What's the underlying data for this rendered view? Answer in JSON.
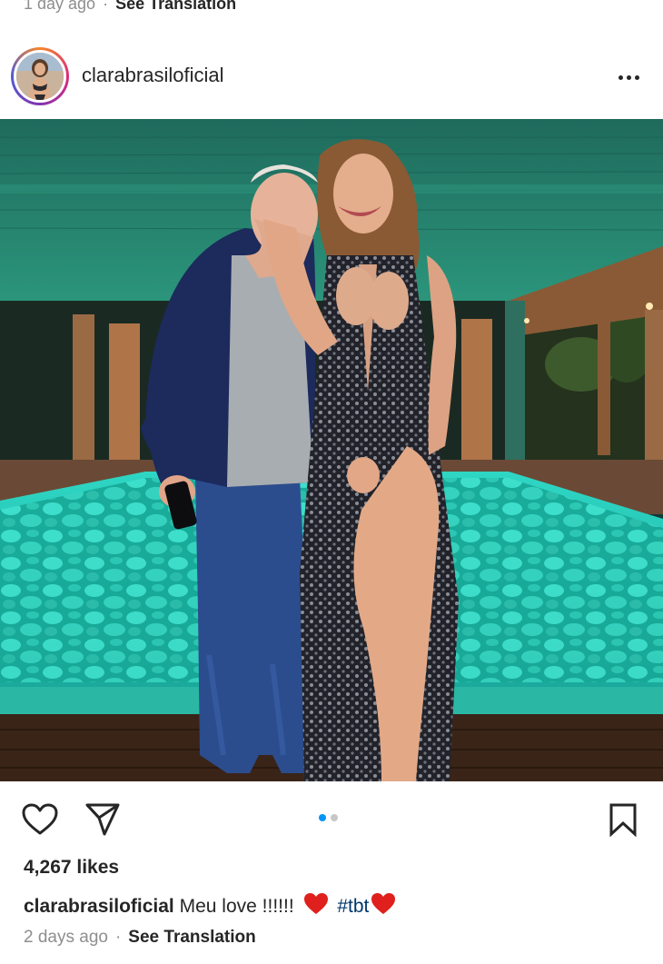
{
  "top": {
    "time": "1 day ago",
    "separator": "·",
    "translate": "See Translation"
  },
  "post": {
    "username": "clarabrasiloficial",
    "more_icon": "more-horizontal-icon",
    "image": {
      "description_icon": "photo",
      "pager": {
        "count": 2,
        "active": 0
      }
    },
    "likes": "4,267 likes",
    "caption": {
      "username": "clarabrasiloficial",
      "text": "Meu love !!!!!!",
      "hashtag": "#tbt"
    },
    "time": "2 days ago",
    "separator": "·",
    "translate": "See Translation"
  },
  "actions": {
    "like_icon": "heart-outline-icon",
    "share_icon": "paper-plane-icon",
    "save_icon": "bookmark-icon"
  },
  "colors": {
    "link": "#00376b",
    "accent_blue": "#0095f6",
    "heart_red": "#e0201c",
    "muted": "#8e8e8e"
  }
}
